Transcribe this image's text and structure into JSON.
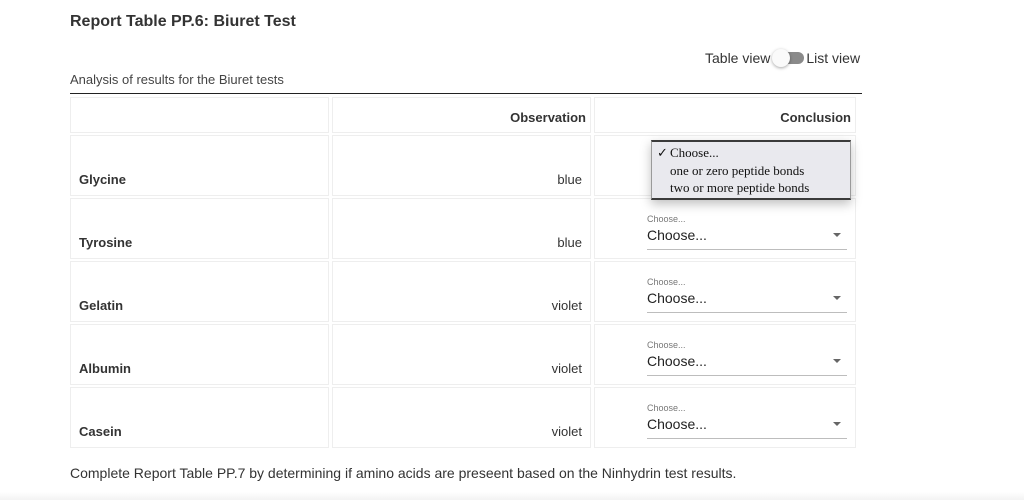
{
  "title": "Report Table PP.6: Biuret Test",
  "view_toggle": {
    "left_label": "Table view",
    "right_label": "List view",
    "state": "list"
  },
  "caption": "Analysis of results for the Biuret tests",
  "table": {
    "headers": [
      "",
      "Observation",
      "Conclusion"
    ],
    "rows": [
      {
        "name": "Glycine",
        "observation": "blue",
        "conclusion_label": "Choose...",
        "conclusion_value": "Choose..."
      },
      {
        "name": "Tyrosine",
        "observation": "blue",
        "conclusion_label": "Choose...",
        "conclusion_value": "Choose..."
      },
      {
        "name": "Gelatin",
        "observation": "violet",
        "conclusion_label": "Choose...",
        "conclusion_value": "Choose..."
      },
      {
        "name": "Albumin",
        "observation": "violet",
        "conclusion_label": "Choose...",
        "conclusion_value": "Choose..."
      },
      {
        "name": "Casein",
        "observation": "violet",
        "conclusion_label": "Choose...",
        "conclusion_value": "Choose..."
      }
    ]
  },
  "open_dropdown": {
    "row": "Glycine",
    "check_glyph": "✓",
    "options": [
      "Choose...",
      "one or zero peptide bonds",
      "two or more peptide bonds"
    ],
    "selected_index": 0
  },
  "footer": "Complete Report Table PP.7 by determining if amino acids are preseent based on the Ninhydrin test results."
}
